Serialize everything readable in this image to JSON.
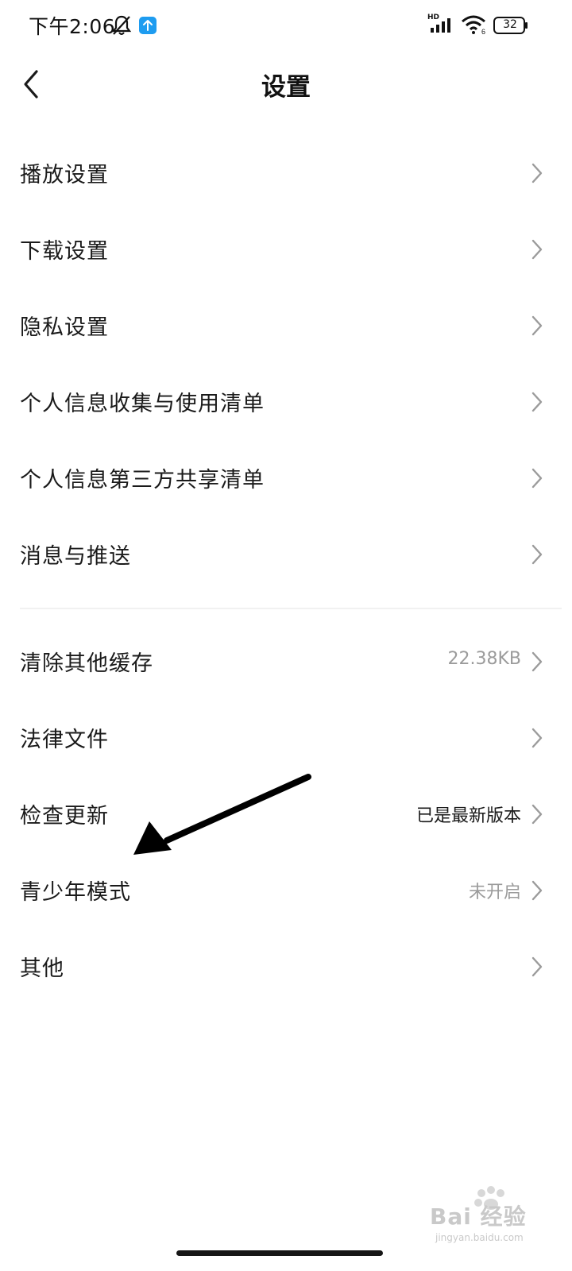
{
  "status_bar": {
    "time": "下午2:06",
    "network": "HD",
    "wifi_badge": "6",
    "battery": "32"
  },
  "header": {
    "title": "设置"
  },
  "settings_group_1": [
    {
      "label": "播放设置"
    },
    {
      "label": "下载设置"
    },
    {
      "label": "隐私设置"
    },
    {
      "label": "个人信息收集与使用清单"
    },
    {
      "label": "个人信息第三方共享清单"
    },
    {
      "label": "消息与推送"
    }
  ],
  "settings_group_2": [
    {
      "label": "清除其他缓存",
      "value": "22.38KB"
    },
    {
      "label": "法律文件",
      "value": ""
    },
    {
      "label": "检查更新",
      "value": "已是最新版本"
    },
    {
      "label": "青少年模式",
      "value": "未开启"
    },
    {
      "label": "其他",
      "value": ""
    }
  ],
  "watermark": {
    "brand": "Bai 经验",
    "url": "jingyan.baidu.com"
  },
  "colors": {
    "background": "#ffffff",
    "text": "#1a1a1a",
    "secondary_text": "#9b9b9b",
    "chevron": "#9b9b9b",
    "accent_upload": "#1e9cf0"
  }
}
